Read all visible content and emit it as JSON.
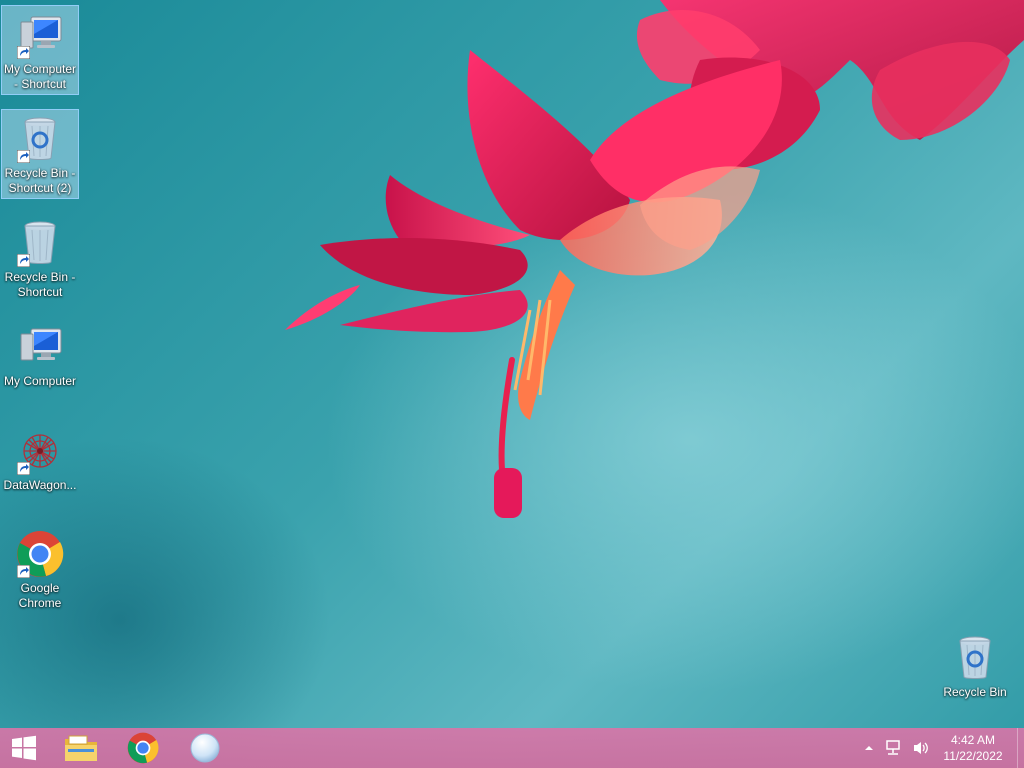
{
  "desktop": {
    "icons": [
      {
        "label": "My Computer - Shortcut",
        "icon": "computer-icon",
        "shortcut": true,
        "selected": true
      },
      {
        "label": "Recycle Bin - Shortcut (2)",
        "icon": "recycle-bin-icon",
        "shortcut": true,
        "selected": true
      },
      {
        "label": "Recycle Bin - Shortcut",
        "icon": "recycle-bin-icon",
        "shortcut": true,
        "selected": false
      },
      {
        "label": "My Computer",
        "icon": "computer-icon",
        "shortcut": false,
        "selected": false
      },
      {
        "label": "DataWagon...",
        "icon": "datawagon-icon",
        "shortcut": true,
        "selected": false
      },
      {
        "label": "Google Chrome",
        "icon": "chrome-icon",
        "shortcut": true,
        "selected": false
      },
      {
        "label": "Recycle Bin",
        "icon": "recycle-bin-icon",
        "shortcut": false,
        "selected": false
      }
    ]
  },
  "taskbar": {
    "start_icon": "windows-logo-icon",
    "pinned": [
      {
        "icon": "file-explorer-icon"
      },
      {
        "icon": "chrome-icon"
      },
      {
        "icon": "orb-app-icon"
      }
    ],
    "tray": {
      "overflow_icon": "chevron-up-icon",
      "network_icon": "network-icon",
      "volume_icon": "volume-icon",
      "time": "4:42 AM",
      "date": "11/22/2022"
    }
  },
  "colors": {
    "taskbar": "#d374a6",
    "wallpaper_teal": "#2f9aa6",
    "flower": "#e0245e"
  }
}
